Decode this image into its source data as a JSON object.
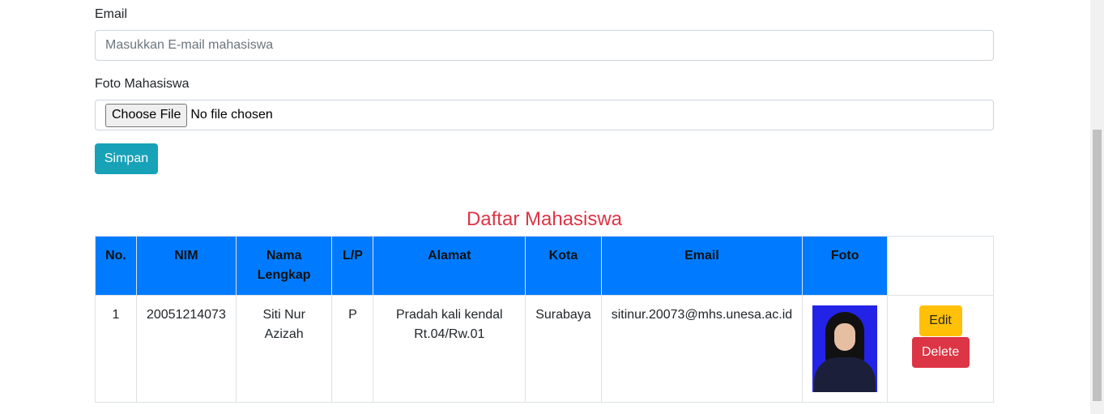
{
  "form": {
    "email_label": "Email",
    "email_placeholder": "Masukkan E-mail mahasiswa",
    "email_value": "",
    "foto_label": "Foto Mahasiswa",
    "file_button_label": "Choose File",
    "file_status": "No file chosen",
    "save_label": "Simpan"
  },
  "table": {
    "title": "Daftar Mahasiswa",
    "headers": [
      "No.",
      "NIM",
      "Nama Lengkap",
      "L/P",
      "Alamat",
      "Kota",
      "Email",
      "Foto",
      ""
    ],
    "rows": [
      {
        "no": "1",
        "nim": "20051214073",
        "nama": "Siti Nur Azizah",
        "lp": "P",
        "alamat": "Pradah kali kendal Rt.04/Rw.01",
        "kota": "Surabaya",
        "email": "sitinur.20073@mhs.unesa.ac.id",
        "foto": "student-photo",
        "edit_label": "Edit",
        "delete_label": "Delete"
      }
    ]
  },
  "colors": {
    "header_bg": "#007bff",
    "title": "#dc3545",
    "save_button": "#17a2b8",
    "edit_button": "#ffc107",
    "delete_button": "#dc3545"
  }
}
